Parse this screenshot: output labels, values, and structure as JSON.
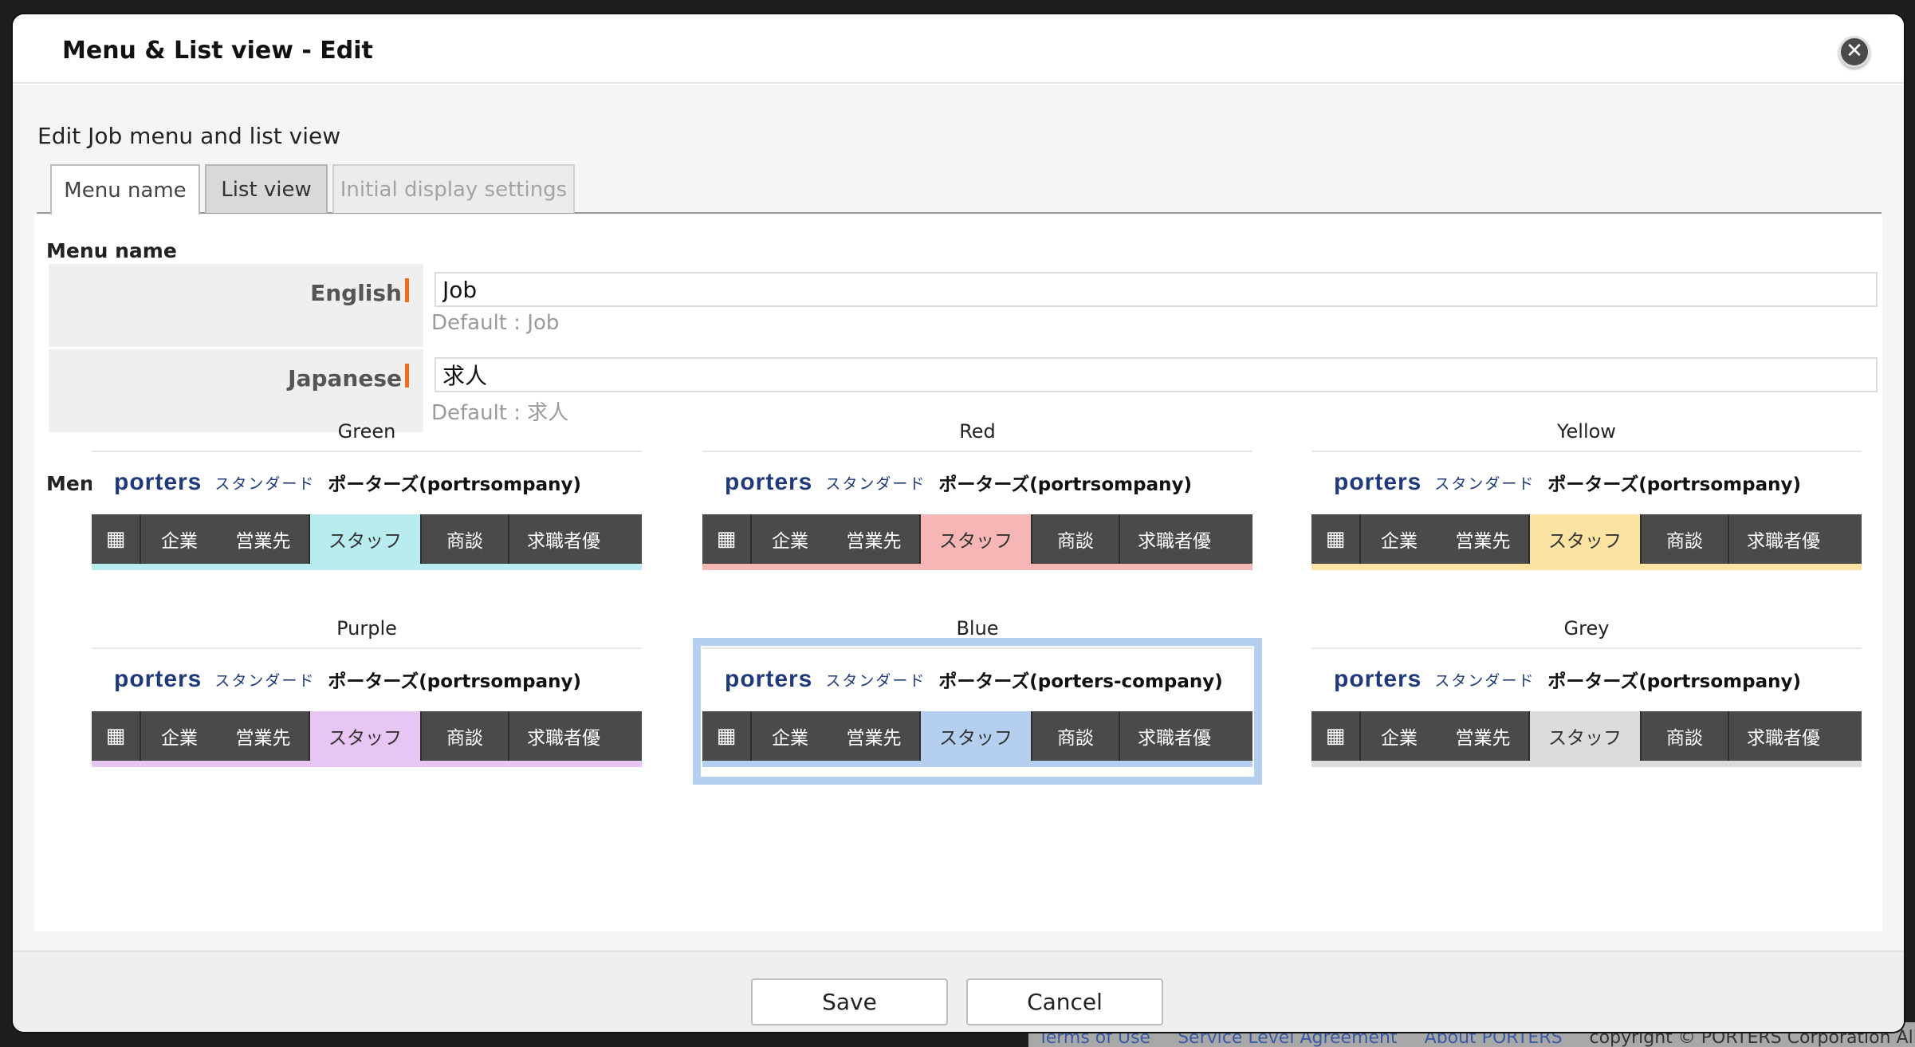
{
  "modal": {
    "title": "Menu & List view - Edit",
    "close_glyph": "✕",
    "subtitle": "Edit Job menu and list view"
  },
  "tabs": [
    {
      "label": "Menu name",
      "state": "active"
    },
    {
      "label": "List view",
      "state": "enabled"
    },
    {
      "label": "Initial display settings",
      "state": "disabled"
    }
  ],
  "menu_name": {
    "section_label": "Menu name",
    "english": {
      "label": "English",
      "value": "Job",
      "default_text": "Default : Job"
    },
    "japanese": {
      "label": "Japanese",
      "value": "求人",
      "default_text": "Default : 求人"
    }
  },
  "menu_theme": {
    "section_label": "Menu Theme",
    "preview": {
      "logo": "porters",
      "edition": "スタンダード",
      "company_default": "ポーターズ(portrsompany)",
      "company_selected": "ポーターズ(porters-company)",
      "nav_grid_icon": "grid-icon",
      "nav_items": [
        "企業",
        "営業先",
        "スタッフ",
        "商談",
        "求職者優"
      ]
    },
    "themes": [
      {
        "name": "Green",
        "accent": "#b8ecef",
        "selected": false
      },
      {
        "name": "Red",
        "accent": "#f7b6b6",
        "selected": false
      },
      {
        "name": "Yellow",
        "accent": "#fbe3a3",
        "selected": false
      },
      {
        "name": "Purple",
        "accent": "#e8c6f3",
        "selected": false
      },
      {
        "name": "Blue",
        "accent": "#b4cff0",
        "selected": true
      },
      {
        "name": "Grey",
        "accent": "#dcdcdc",
        "selected": false
      }
    ]
  },
  "footer": {
    "save_label": "Save",
    "cancel_label": "Cancel"
  },
  "background_footer": {
    "links": [
      "Terms of Use",
      "Service Level Agreement",
      "About PORTERS"
    ],
    "copyright": "copyright © PORTERS Corporation All Rights"
  },
  "colors": {
    "required_marker": "#f26a1b",
    "nav_bar": "#4a4a4a",
    "selected_outline": "#b4cff0"
  }
}
